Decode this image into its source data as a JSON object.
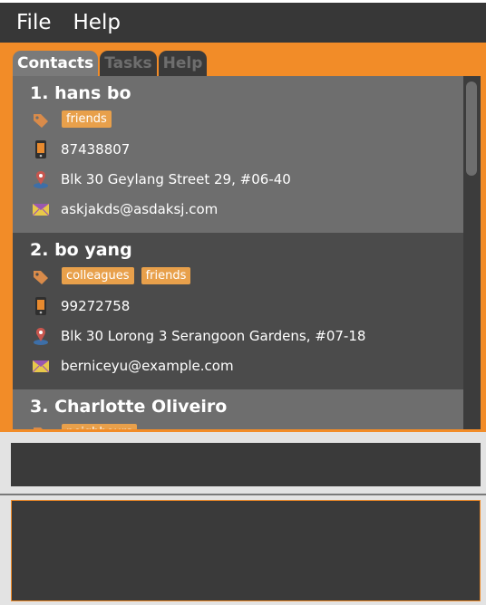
{
  "menu": {
    "file": "File",
    "help": "Help"
  },
  "tabs": [
    "Contacts",
    "Tasks",
    "Help"
  ],
  "contacts": [
    {
      "index": "1.",
      "name": "hans bo",
      "tags": [
        "friends"
      ],
      "phone": "87438807",
      "address": "Blk 30 Geylang Street 29, #06-40",
      "email": "askjakds@asdaksj.com"
    },
    {
      "index": "2.",
      "name": "bo yang",
      "tags": [
        "colleagues",
        "friends"
      ],
      "phone": "99272758",
      "address": "Blk 30 Lorong 3 Serangoon Gardens, #07-18",
      "email": "berniceyu@example.com"
    },
    {
      "index": "3.",
      "name": "Charlotte Oliveiro",
      "tags": [
        "neighbours"
      ]
    }
  ],
  "colors": {
    "accent": "#f28c28",
    "tag": "#e8a04b",
    "card_odd": "#6e6e6e",
    "card_even": "#4b4b4b",
    "menubar": "#373737"
  }
}
